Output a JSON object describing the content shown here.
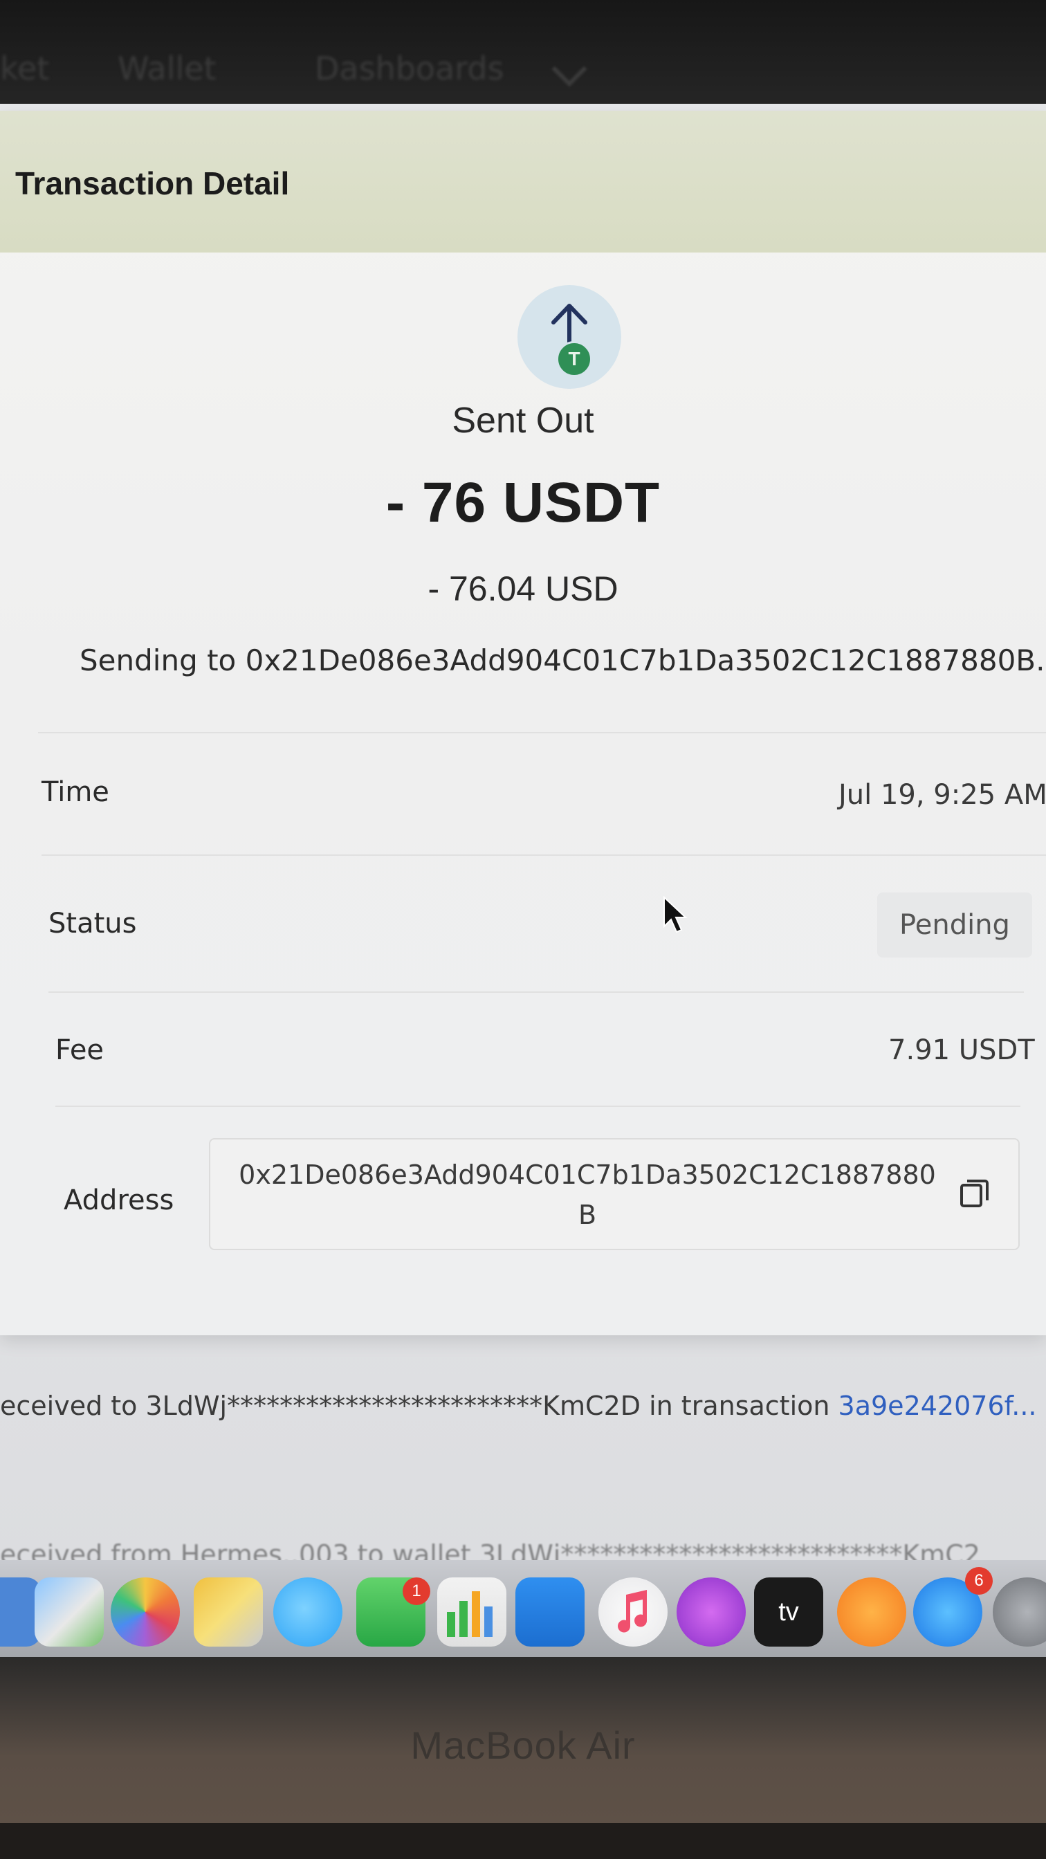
{
  "nav": {
    "items": [
      "ket",
      "Wallet",
      "Dashboards"
    ]
  },
  "modal": {
    "title": "Transaction Detail",
    "icon": "send-arrow-up-icon",
    "token_badge": "T",
    "direction_label": "Sent Out",
    "amount": "- 76 USDT",
    "amount_usd": "- 76.04 USD",
    "sending_to": "Sending to 0x21De086e3Add904C01C7b1Da3502C12C1887880B.",
    "rows": {
      "time": {
        "label": "Time",
        "value": "Jul 19, 9:25 AM"
      },
      "status": {
        "label": "Status",
        "value": "Pending"
      },
      "fee": {
        "label": "Fee",
        "value": "7.91 USDT"
      },
      "address": {
        "label": "Address",
        "value": "0x21De086e3Add904C01C7b1Da3502C12C1887880B"
      }
    }
  },
  "activity": {
    "line1_text": "eceived to 3LdWj************************KmC2D in transaction ",
    "line1_link": "3a9e242076f...",
    "line2_text": "eceived from Hermes..003 to wallet 3LdWj**************************KmC2"
  },
  "dock": {
    "notification_badge_facetime": "1",
    "notification_badge_appstore": "6",
    "tv_label": "tv"
  },
  "laptop": {
    "brand": "MacBook Air"
  },
  "colors": {
    "header_bg": "#d8dcc3",
    "badge_green": "#2f8f56",
    "link_blue": "#2f5fbf"
  }
}
